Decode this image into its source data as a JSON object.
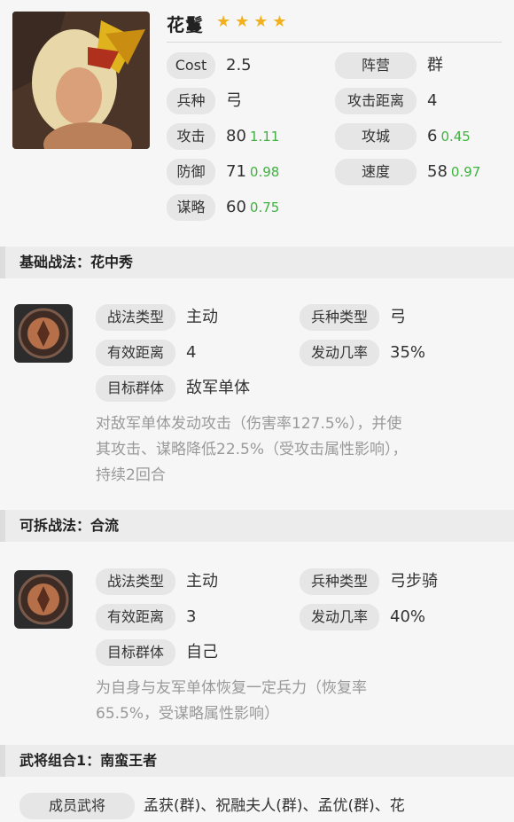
{
  "hero": {
    "name": "花鬘",
    "stars": "★★★★",
    "stats": [
      {
        "label": "Cost",
        "value": "2.5",
        "growth": ""
      },
      {
        "label": "阵营",
        "value": "群",
        "growth": ""
      },
      {
        "label": "兵种",
        "value": "弓",
        "growth": ""
      },
      {
        "label": "攻击距离",
        "value": "4",
        "growth": ""
      },
      {
        "label": "攻击",
        "value": "80",
        "growth": "1.11"
      },
      {
        "label": "攻城",
        "value": "6",
        "growth": "0.45"
      },
      {
        "label": "防御",
        "value": "71",
        "growth": "0.98"
      },
      {
        "label": "速度",
        "value": "58",
        "growth": "0.97"
      },
      {
        "label": "谋略",
        "value": "60",
        "growth": "0.75"
      }
    ]
  },
  "skill1": {
    "header": "基础战法：花中秀",
    "type_label": "战法类型",
    "type_value": "主动",
    "troop_label": "兵种类型",
    "troop_value": "弓",
    "range_label": "有效距离",
    "range_value": "4",
    "rate_label": "发动几率",
    "rate_value": "35%",
    "target_label": "目标群体",
    "target_value": "敌军单体",
    "desc_lines": [
      "对敌军单体发动攻击（伤害率127.5%），并使",
      "其攻击、谋略降低22.5%（受攻击属性影响），",
      "持续2回合"
    ]
  },
  "skill2": {
    "header": "可拆战法：合流",
    "type_label": "战法类型",
    "type_value": "主动",
    "troop_label": "兵种类型",
    "troop_value": "弓步骑",
    "range_label": "有效距离",
    "range_value": "3",
    "rate_label": "发动几率",
    "rate_value": "40%",
    "target_label": "目标群体",
    "target_value": "自己",
    "desc_lines": [
      "为自身与友军单体恢复一定兵力（恢复率",
      "65.5%，受谋略属性影响）"
    ]
  },
  "combo": {
    "header": "武将组合1：南蛮王者",
    "member_label": "成员武将",
    "members": "孟获(群)、祝融夫人(群)、孟优(群)、花"
  },
  "icons": {
    "portrait": "hero-portrait",
    "skill": "skill-emblem-icon",
    "star": "star-icon"
  },
  "colors": {
    "growth": "#3fb23f",
    "star": "#f2b01e",
    "label_bg": "#e6e6e6"
  }
}
